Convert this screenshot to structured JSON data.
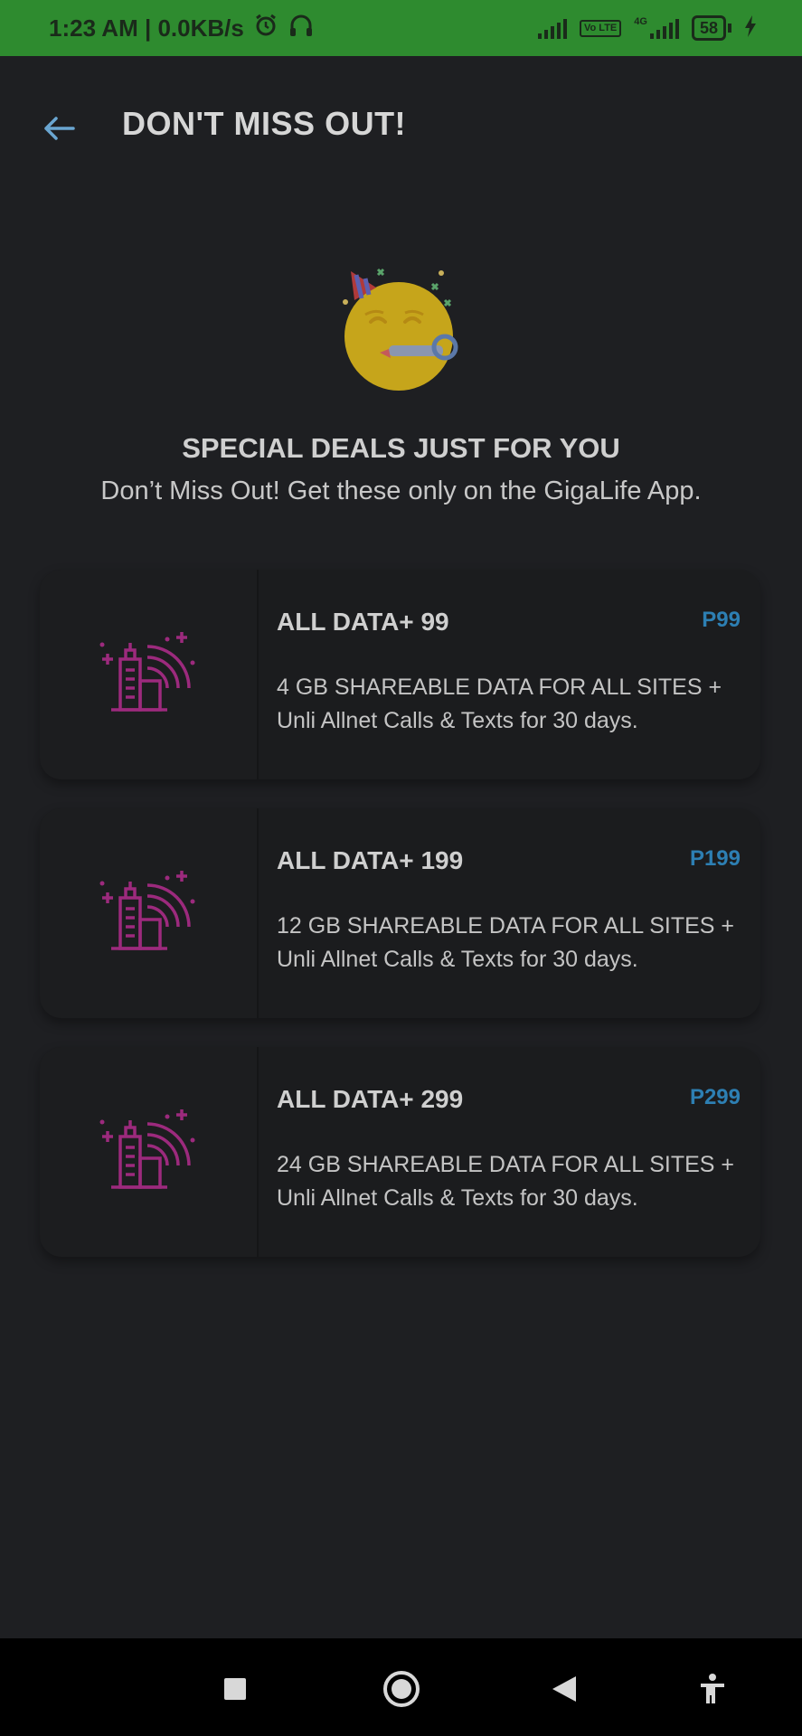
{
  "status_bar": {
    "time_speed": "1:23 AM | 0.0KB/s",
    "icons": [
      "alarm-icon",
      "headset-icon",
      "signal-icon",
      "volte-icon",
      "4g-icon",
      "battery-icon",
      "charging-icon"
    ],
    "volte": "Vo LTE",
    "network": "4G",
    "battery": "58"
  },
  "header": {
    "back_icon": "arrow-left-icon",
    "title": "DON'T MISS OUT!"
  },
  "hero": {
    "icon": "party-face-emoji",
    "title": "SPECIAL DEALS JUST FOR YOU",
    "subtitle": "Don’t Miss Out! Get these only on the GigaLife App."
  },
  "deals": [
    {
      "name": "ALL DATA+ 99",
      "price": "P99",
      "description": "4 GB SHAREABLE DATA FOR ALL SITES + Unli Allnet Calls & Texts for 30 days.",
      "icon": "city-signal-icon"
    },
    {
      "name": "ALL DATA+ 199",
      "price": "P199",
      "description": "12 GB SHAREABLE DATA FOR ALL SITES + Unli Allnet Calls & Texts for 30 days.",
      "icon": "city-signal-icon"
    },
    {
      "name": "ALL DATA+ 299",
      "price": "P299",
      "description": "24 GB SHAREABLE DATA FOR ALL SITES + Unli Allnet Calls & Texts for 30 days.",
      "icon": "city-signal-icon"
    }
  ],
  "colors": {
    "status_bar": "#2e8b2f",
    "background": "#1e1f22",
    "card": "#1b1c1e",
    "price": "#2d7fb3",
    "icon": "#9c2a7d",
    "back_arrow": "#6aa6d1"
  },
  "nav_bar": {
    "buttons": [
      "recents-square-icon",
      "home-circle-icon",
      "back-triangle-icon",
      "accessibility-icon"
    ]
  }
}
